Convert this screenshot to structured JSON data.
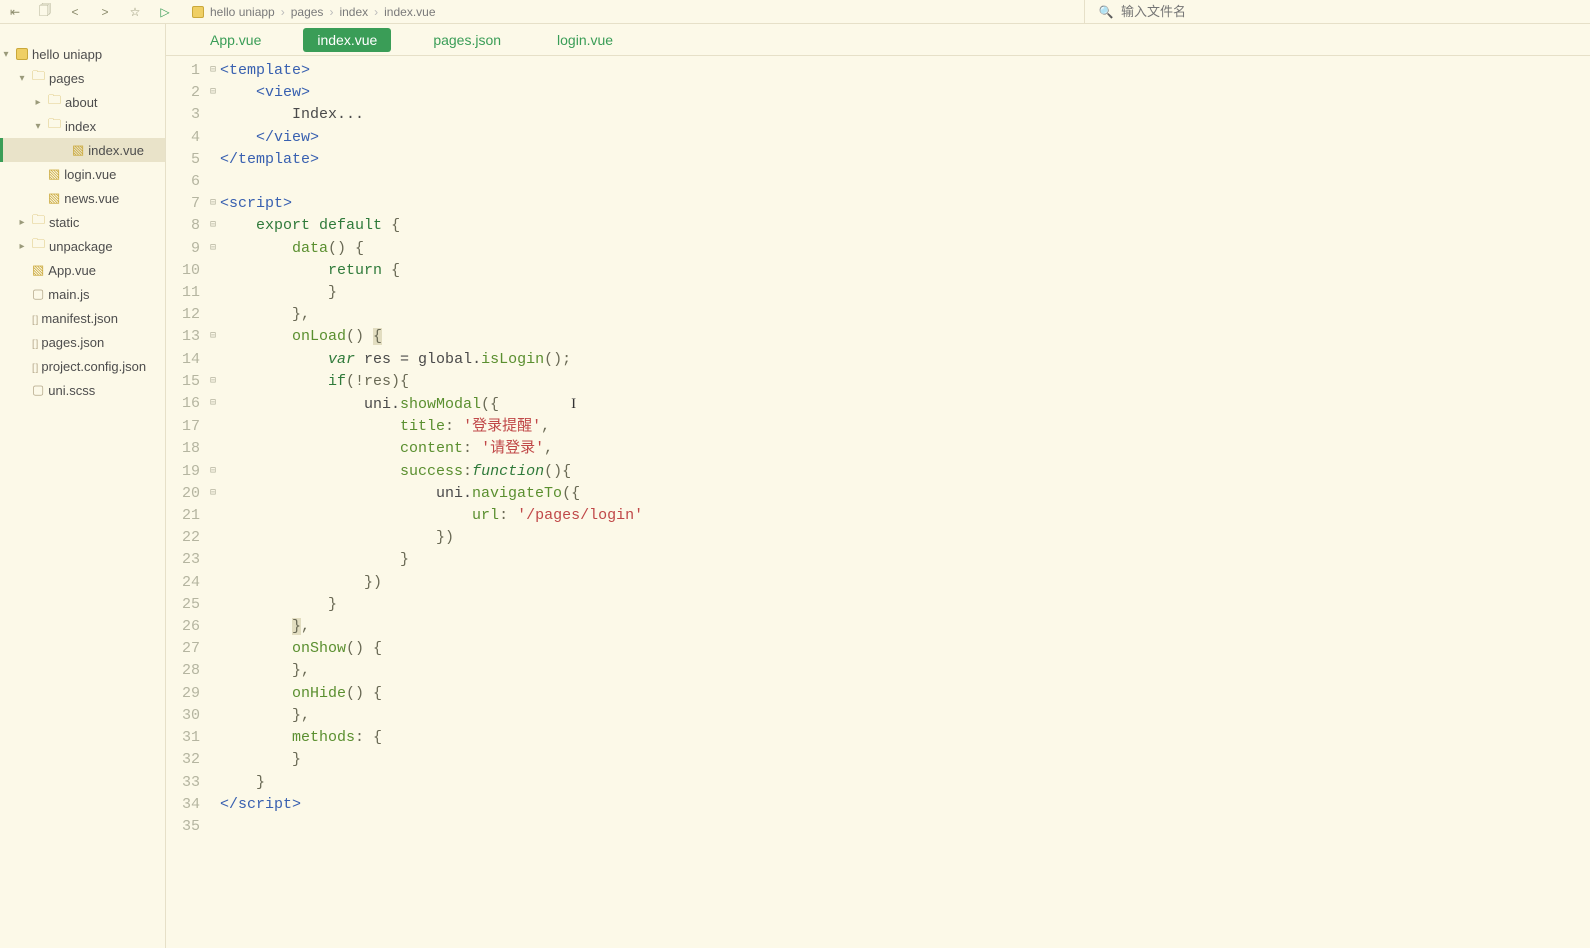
{
  "toolbar": {
    "breadcrumb": [
      "hello uniapp",
      "pages",
      "index",
      "index.vue"
    ],
    "search_placeholder": "输入文件名"
  },
  "sidebar": {
    "tree": [
      {
        "indent": 1,
        "chev": "▾",
        "kind": "project",
        "label": "hello uniapp"
      },
      {
        "indent": 2,
        "chev": "▾",
        "kind": "folder",
        "label": "pages"
      },
      {
        "indent": 3,
        "chev": "▸",
        "kind": "folder",
        "label": "about"
      },
      {
        "indent": 3,
        "chev": "▾",
        "kind": "folder",
        "label": "index"
      },
      {
        "indent": 4,
        "chev": "",
        "kind": "vue",
        "label": "index.vue",
        "selected": true
      },
      {
        "indent": 3,
        "chev": "",
        "kind": "vue",
        "label": "login.vue"
      },
      {
        "indent": 3,
        "chev": "",
        "kind": "vue",
        "label": "news.vue"
      },
      {
        "indent": 2,
        "chev": "▸",
        "kind": "folder",
        "label": "static"
      },
      {
        "indent": 2,
        "chev": "▸",
        "kind": "folder",
        "label": "unpackage"
      },
      {
        "indent": 2,
        "chev": "",
        "kind": "vue",
        "label": "App.vue"
      },
      {
        "indent": 2,
        "chev": "",
        "kind": "js",
        "label": "main.js"
      },
      {
        "indent": 2,
        "chev": "",
        "kind": "json",
        "label": "manifest.json"
      },
      {
        "indent": 2,
        "chev": "",
        "kind": "json",
        "label": "pages.json"
      },
      {
        "indent": 2,
        "chev": "",
        "kind": "json",
        "label": "project.config.json"
      },
      {
        "indent": 2,
        "chev": "",
        "kind": "scss",
        "label": "uni.scss"
      }
    ]
  },
  "tabs": [
    {
      "label": "App.vue",
      "active": false
    },
    {
      "label": "index.vue",
      "active": true
    },
    {
      "label": "pages.json",
      "active": false
    },
    {
      "label": "login.vue",
      "active": false
    }
  ],
  "code": {
    "lines": [
      {
        "n": 1,
        "fold": "⊟",
        "tokens": [
          [
            "<template>",
            "c-tag"
          ]
        ]
      },
      {
        "n": 2,
        "fold": "⊟",
        "tokens": [
          [
            "    ",
            ""
          ],
          [
            "<view>",
            "c-tag"
          ]
        ]
      },
      {
        "n": 3,
        "fold": "",
        "tokens": [
          [
            "        Index...",
            "c-var"
          ]
        ]
      },
      {
        "n": 4,
        "fold": "",
        "tokens": [
          [
            "    ",
            ""
          ],
          [
            "</view>",
            "c-tag"
          ]
        ]
      },
      {
        "n": 5,
        "fold": "",
        "tokens": [
          [
            "</template>",
            "c-tag"
          ]
        ]
      },
      {
        "n": 6,
        "fold": "",
        "tokens": [
          [
            "",
            ""
          ]
        ]
      },
      {
        "n": 7,
        "fold": "⊟",
        "tokens": [
          [
            "<script>",
            "c-tag"
          ]
        ]
      },
      {
        "n": 8,
        "fold": "⊟",
        "tokens": [
          [
            "    ",
            ""
          ],
          [
            "export",
            "c-kw"
          ],
          [
            " ",
            ""
          ],
          [
            "default",
            "c-kw"
          ],
          [
            " {",
            "c-pun"
          ]
        ]
      },
      {
        "n": 9,
        "fold": "⊟",
        "tokens": [
          [
            "        ",
            ""
          ],
          [
            "data",
            "c-fn"
          ],
          [
            "() {",
            "c-pun"
          ]
        ]
      },
      {
        "n": 10,
        "fold": "",
        "tokens": [
          [
            "            ",
            ""
          ],
          [
            "return",
            "c-kw"
          ],
          [
            " {",
            "c-pun"
          ]
        ]
      },
      {
        "n": 11,
        "fold": "",
        "tokens": [
          [
            "            }",
            "c-pun"
          ]
        ]
      },
      {
        "n": 12,
        "fold": "",
        "tokens": [
          [
            "        },",
            "c-pun"
          ]
        ]
      },
      {
        "n": 13,
        "fold": "⊟",
        "tokens": [
          [
            "        ",
            ""
          ],
          [
            "onLoad",
            "c-fn"
          ],
          [
            "() ",
            "c-pun"
          ],
          [
            "{",
            "c-pun c-box"
          ]
        ]
      },
      {
        "n": 14,
        "fold": "",
        "tokens": [
          [
            "            ",
            ""
          ],
          [
            "var",
            "c-kw-i"
          ],
          [
            " res = global.",
            "c-var"
          ],
          [
            "isLogin",
            "c-fn"
          ],
          [
            "();",
            "c-pun"
          ]
        ]
      },
      {
        "n": 15,
        "fold": "⊟",
        "tokens": [
          [
            "            ",
            ""
          ],
          [
            "if",
            "c-kw"
          ],
          [
            "(!res){",
            "c-pun"
          ]
        ]
      },
      {
        "n": 16,
        "fold": "⊟",
        "tokens": [
          [
            "                uni.",
            "c-var"
          ],
          [
            "showModal",
            "c-fn"
          ],
          [
            "({",
            "c-pun"
          ],
          [
            "        ",
            ""
          ],
          [
            "CARET",
            ""
          ]
        ]
      },
      {
        "n": 17,
        "fold": "",
        "tokens": [
          [
            "                    ",
            ""
          ],
          [
            "title",
            "c-prop"
          ],
          [
            ": ",
            "c-pun"
          ],
          [
            "'登录提醒'",
            "c-str"
          ],
          [
            ",",
            "c-pun"
          ]
        ]
      },
      {
        "n": 18,
        "fold": "",
        "tokens": [
          [
            "                    ",
            ""
          ],
          [
            "content",
            "c-prop"
          ],
          [
            ": ",
            "c-pun"
          ],
          [
            "'请登录'",
            "c-str"
          ],
          [
            ",",
            "c-pun"
          ]
        ]
      },
      {
        "n": 19,
        "fold": "⊟",
        "tokens": [
          [
            "                    ",
            ""
          ],
          [
            "success",
            "c-prop"
          ],
          [
            ":",
            "c-pun"
          ],
          [
            "function",
            "c-kw-i"
          ],
          [
            "(){",
            "c-pun"
          ]
        ]
      },
      {
        "n": 20,
        "fold": "⊟",
        "tokens": [
          [
            "                        uni.",
            "c-var"
          ],
          [
            "navigateTo",
            "c-fn"
          ],
          [
            "({",
            "c-pun"
          ]
        ]
      },
      {
        "n": 21,
        "fold": "",
        "tokens": [
          [
            "                            ",
            ""
          ],
          [
            "url",
            "c-prop"
          ],
          [
            ": ",
            "c-pun"
          ],
          [
            "'/pages/login'",
            "c-str"
          ]
        ]
      },
      {
        "n": 22,
        "fold": "",
        "tokens": [
          [
            "                        })",
            "c-pun"
          ]
        ]
      },
      {
        "n": 23,
        "fold": "",
        "tokens": [
          [
            "                    }",
            "c-pun"
          ]
        ]
      },
      {
        "n": 24,
        "fold": "",
        "tokens": [
          [
            "                })",
            "c-pun"
          ]
        ]
      },
      {
        "n": 25,
        "fold": "",
        "tokens": [
          [
            "            }",
            "c-pun"
          ]
        ]
      },
      {
        "n": 26,
        "fold": "",
        "tokens": [
          [
            "        ",
            ""
          ],
          [
            "}",
            "c-pun c-box"
          ],
          [
            ",",
            "c-pun"
          ]
        ]
      },
      {
        "n": 27,
        "fold": "",
        "tokens": [
          [
            "        ",
            ""
          ],
          [
            "onShow",
            "c-fn"
          ],
          [
            "() {",
            "c-pun"
          ]
        ]
      },
      {
        "n": 28,
        "fold": "",
        "tokens": [
          [
            "        },",
            "c-pun"
          ]
        ]
      },
      {
        "n": 29,
        "fold": "",
        "tokens": [
          [
            "        ",
            ""
          ],
          [
            "onHide",
            "c-fn"
          ],
          [
            "() {",
            "c-pun"
          ]
        ]
      },
      {
        "n": 30,
        "fold": "",
        "tokens": [
          [
            "        },",
            "c-pun"
          ]
        ]
      },
      {
        "n": 31,
        "fold": "",
        "tokens": [
          [
            "        ",
            ""
          ],
          [
            "methods",
            "c-prop"
          ],
          [
            ": {",
            "c-pun"
          ]
        ]
      },
      {
        "n": 32,
        "fold": "",
        "tokens": [
          [
            "        }",
            "c-pun"
          ]
        ]
      },
      {
        "n": 33,
        "fold": "",
        "tokens": [
          [
            "    }",
            "c-pun"
          ]
        ]
      },
      {
        "n": 34,
        "fold": "",
        "tokens": [
          [
            "</script>",
            "c-tag"
          ]
        ]
      },
      {
        "n": 35,
        "fold": "",
        "tokens": [
          [
            "",
            ""
          ]
        ]
      }
    ]
  }
}
